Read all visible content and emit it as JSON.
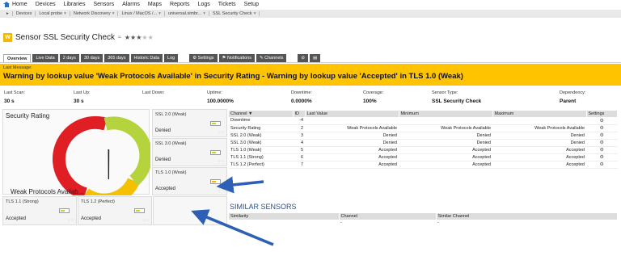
{
  "nav": {
    "items": [
      "Home",
      "Devices",
      "Libraries",
      "Sensors",
      "Alarms",
      "Maps",
      "Reports",
      "Logs",
      "Tickets",
      "Setup"
    ]
  },
  "breadcrumb": [
    "Devices",
    "Local probe",
    "Network Discovery",
    "Linux / MacOS /...",
    "universal.simbr...",
    "SSL Security Check"
  ],
  "header": {
    "badge": "W",
    "title": "Sensor SSL Security Check",
    "pin": "≈",
    "stars_on": "★★★",
    "stars_off": "★★"
  },
  "tabs": [
    "Overview",
    "Live Data",
    "2 days",
    "30 days",
    "365 days",
    "Historic Data",
    "Log"
  ],
  "toolbar": {
    "settings": "⚙ Settings",
    "notifications": "⚑ Notifications",
    "channels": "✎ Channels",
    "icon_a": "⊘",
    "icon_b": "▤"
  },
  "alert": {
    "label": "Last Message:",
    "message": "Warning by lookup value 'Weak Protocols Available' in Security Rating - Warning by lookup value 'Accepted' in TLS 1.0 (Weak)",
    "color": "#ffc300"
  },
  "stats": [
    {
      "label": "Last Scan:",
      "value": "30 s"
    },
    {
      "label": "Last Up:",
      "value": "30 s"
    },
    {
      "label": "Last Down:",
      "value": ""
    },
    {
      "label": "Uptime:",
      "value": "100.0000%"
    },
    {
      "label": "Downtime:",
      "value": "0.0000%"
    },
    {
      "label": "Coverage:",
      "value": "100%"
    },
    {
      "label": "Sensor Type:",
      "value": "SSL Security Check"
    },
    {
      "label": "Dependency:",
      "value": "Parent"
    }
  ],
  "gauge": {
    "title": "Security Rating",
    "value": "Weak Protocols Availab...",
    "dots": "○ ○"
  },
  "tiles": [
    {
      "name": "SSL 2.0 (Weak)",
      "status": "Denied"
    },
    {
      "name": "SSL 3.0 (Weak)",
      "status": "Denied"
    },
    {
      "name": "TLS 1.0 (Weak)",
      "status": "Accepted"
    },
    {
      "name": "TLS 1.1 (Strong)",
      "status": "Accepted"
    },
    {
      "name": "TLS 1.2 (Perfect)",
      "status": "Accepted"
    }
  ],
  "channels": {
    "headers": [
      "Channel ▼",
      "ID",
      "Last Value",
      "Minimum",
      "Maximum",
      "Settings"
    ],
    "rows": [
      {
        "channel": "Downtime",
        "id": "-4",
        "last": "",
        "min": "",
        "max": ""
      },
      {
        "channel": "Security Rating",
        "id": "2",
        "last": "Weak Protocols Available",
        "min": "Weak Protocols Available",
        "max": "Weak Protocols Available"
      },
      {
        "channel": "SSL 2.0 (Weak)",
        "id": "3",
        "last": "Denied",
        "min": "Denied",
        "max": "Denied"
      },
      {
        "channel": "SSL 3.0 (Weak)",
        "id": "4",
        "last": "Denied",
        "min": "Denied",
        "max": "Denied"
      },
      {
        "channel": "TLS 1.0 (Weak)",
        "id": "5",
        "last": "Accepted",
        "min": "Accepted",
        "max": "Accepted"
      },
      {
        "channel": "TLS 1.1 (Strong)",
        "id": "6",
        "last": "Accepted",
        "min": "Accepted",
        "max": "Accepted"
      },
      {
        "channel": "TLS 1.2 (Perfect)",
        "id": "7",
        "last": "Accepted",
        "min": "Accepted",
        "max": "Accepted"
      }
    ],
    "gear": "⚙"
  },
  "similar": {
    "title": "SIMILAR SENSORS",
    "headers": [
      "Similarity",
      "Channel",
      "Similar Channel"
    ],
    "row": [
      "",
      "-",
      "-"
    ]
  }
}
